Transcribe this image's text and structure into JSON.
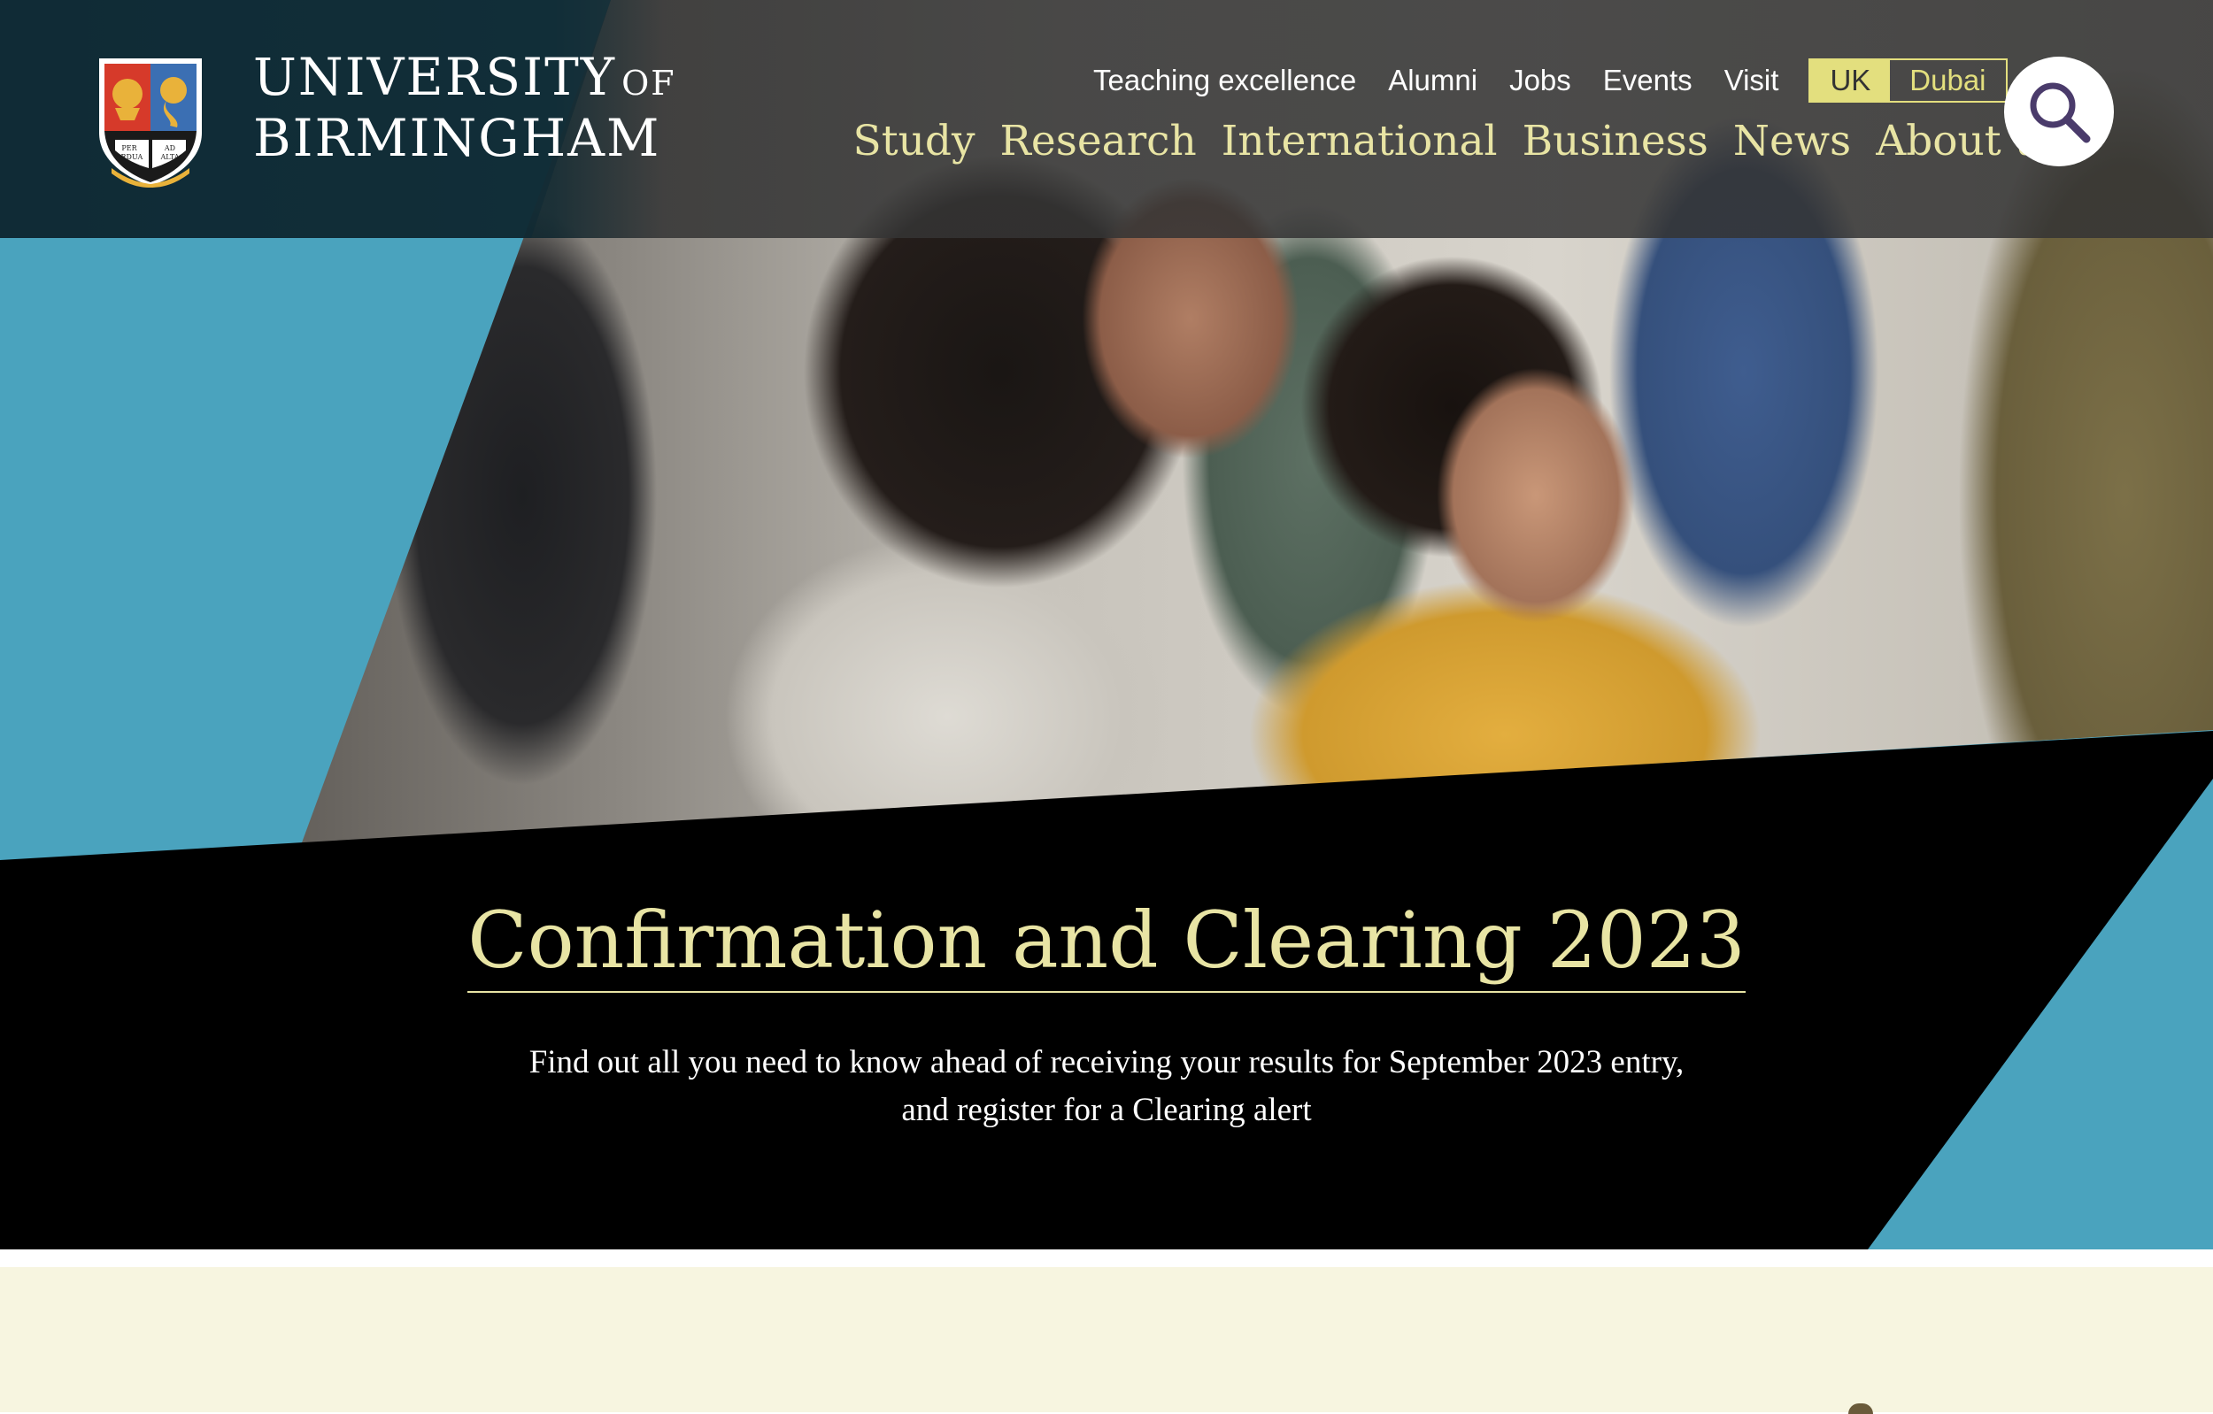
{
  "branding": {
    "name_line1": "UNIVERSITY",
    "name_of": "OF",
    "name_line2": "BIRMINGHAM",
    "crest_motto": [
      "PER",
      "ARDUA",
      "AD",
      "ALTA"
    ]
  },
  "utility_nav": {
    "items": [
      "Teaching excellence",
      "Alumni",
      "Jobs",
      "Events",
      "Visit"
    ]
  },
  "region_switch": {
    "options": [
      "UK",
      "Dubai"
    ],
    "selected": "UK"
  },
  "main_nav": {
    "items": [
      "Study",
      "Research",
      "International",
      "Business",
      "News",
      "About us"
    ]
  },
  "search": {
    "icon": "search-icon"
  },
  "hero": {
    "title": "Confirmation and Clearing 2023",
    "subtitle_line1": "Find out all you need to know ahead of receiving your results for September 2023 entry,",
    "subtitle_line2": "and register for a Clearing alert"
  },
  "colors": {
    "accent_gold": "#e8e4a4",
    "region_highlight": "#e3df7e",
    "hero_blue": "#4aa3be",
    "header_bg": "#343434",
    "band_black": "#000000",
    "cream_section": "#f7f5e0"
  }
}
